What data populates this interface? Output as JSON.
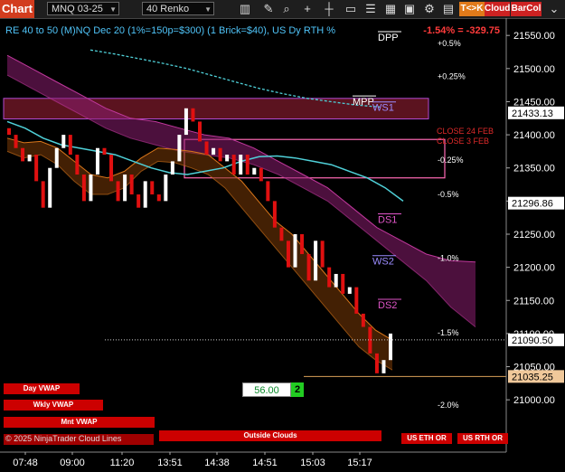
{
  "toolbar": {
    "chart_label": "Chart",
    "instrument": "MNQ 03-25",
    "period": "40 Renko",
    "buttons": [
      {
        "label": "T<>K",
        "color": "#e07a1a"
      },
      {
        "label": "Cloud",
        "color": "#cc2222"
      },
      {
        "label": "BarCol",
        "color": "#cc2222"
      }
    ],
    "icons": [
      "bars-icon",
      "pencil-icon",
      "zoom-icon",
      "plus-icon",
      "crosshair-icon",
      "data-box-icon",
      "list-icon",
      "grid-icon",
      "window-icon",
      "strategy-icon",
      "tile-icon"
    ]
  },
  "header": {
    "info": "RE 40 to 50 (M)NQ Dec 20 (1%=150p=$300) (1 Brick=$40), US Dy RTH %",
    "change": "-1.54% = -329.75"
  },
  "bottom_buttons": [
    {
      "label": "Day VWAP"
    },
    {
      "label": "Wkly VWAP"
    },
    {
      "label": "Mnt VWAP"
    },
    {
      "label": "Outside Clouds"
    },
    {
      "label": "US ETH OR"
    },
    {
      "label": "US RTH OR"
    }
  ],
  "copyright": "© 2025 NinjaTrader Cloud Lines",
  "signal": {
    "value": "56.00",
    "badge": "2"
  },
  "chart_data": {
    "type": "line",
    "title": "",
    "xlabel": "",
    "ylabel": "",
    "ylim": [
      20962,
      21568
    ],
    "x_ticks": [
      "07:48",
      "09:00",
      "11:20",
      "13:51",
      "14:38",
      "14:51",
      "15:03",
      "15:17"
    ],
    "y_ticks": [
      21000,
      21050,
      21100,
      21150,
      21200,
      21250,
      21300,
      21350,
      21400,
      21450,
      21500,
      21550
    ],
    "price_boxes": [
      {
        "label": "21433.13",
        "value": 21433.13,
        "bg": "#ffffff",
        "fg": "#000000"
      },
      {
        "label": "21296.86",
        "value": 21296.86,
        "bg": "#ffffff",
        "fg": "#000000"
      },
      {
        "label": "21090.50",
        "value": 21090.5,
        "bg": "#ffffff",
        "fg": "#000000"
      },
      {
        "label": "21035.25",
        "value": 21035.25,
        "bg": "#f0c89a",
        "fg": "#000000"
      }
    ],
    "levels": [
      {
        "label": "DPP",
        "value": 21542,
        "color": "#ffffff"
      },
      {
        "label": "MPP",
        "value": 21445,
        "color": "#ffffff"
      },
      {
        "label": "WS1",
        "value": 21436,
        "color": "#9b8cff"
      },
      {
        "label": "DS1",
        "value": 21267,
        "color": "#e055c8"
      },
      {
        "label": "WS2",
        "value": 21204,
        "color": "#9b8cff"
      },
      {
        "label": "DS2",
        "value": 21138,
        "color": "#e055c8"
      }
    ],
    "pct_labels": [
      {
        "label": "+0.5%",
        "value": 21534
      },
      {
        "label": "+0.25%",
        "value": 21484
      },
      {
        "label": "-0.25%",
        "value": 21358
      },
      {
        "label": "-0.5%",
        "value": 21306
      },
      {
        "label": "-1.0%",
        "value": 21210
      },
      {
        "label": "-1.5%",
        "value": 21097
      },
      {
        "label": "-2.0%",
        "value": 20988
      }
    ],
    "annotations": [
      {
        "label": "CLOSE 24 FEB",
        "value": 21415
      },
      {
        "label": "CLOSE 3 FEB",
        "value": 21400
      }
    ],
    "series": [
      {
        "name": "Renko",
        "values": [
          21400,
          21380,
          21360,
          21370,
          21330,
          21290,
          21350,
          21380,
          21400,
          21370,
          21340,
          21300,
          21340,
          21380,
          21370,
          21330,
          21300,
          21340,
          21310,
          21290,
          21330,
          21310,
          21300,
          21340,
          21360,
          21400,
          21440,
          21420,
          21390,
          21370,
          21380,
          21360,
          21370,
          21340,
          21370,
          21340,
          21350,
          21330,
          21300,
          21260,
          21240,
          21200,
          21250,
          21220,
          21180,
          21240,
          21200,
          21170,
          21190,
          21160,
          21170,
          21130,
          21110,
          21070,
          21040,
          21060,
          21100
        ]
      },
      {
        "name": "Cyan MA",
        "values": [
          21420,
          21410,
          21395,
          21385,
          21380,
          21375,
          21370,
          21360,
          21350,
          21343,
          21340,
          21345,
          21350,
          21360,
          21367,
          21368,
          21365,
          21360,
          21355,
          21345,
          21335,
          21320,
          21300
        ]
      },
      {
        "name": "Dashed MA",
        "values": [
          21528,
          21522,
          21515,
          21508,
          21500,
          21490,
          21480,
          21470,
          21462,
          21455,
          21450,
          21445,
          21442
        ]
      },
      {
        "name": "Orange Cloud Upper",
        "values": [
          21395,
          21388,
          21390,
          21380,
          21360,
          21340,
          21335,
          21345,
          21365,
          21380,
          21378,
          21375,
          21370,
          21350,
          21330,
          21300,
          21270,
          21250,
          21220,
          21190,
          21160,
          21130,
          21105,
          21090
        ]
      },
      {
        "name": "Orange Cloud Lower",
        "values": [
          21375,
          21365,
          21370,
          21355,
          21330,
          21310,
          21310,
          21320,
          21345,
          21360,
          21358,
          21350,
          21340,
          21320,
          21290,
          21260,
          21230,
          21200,
          21170,
          21140,
          21110,
          21080,
          21060,
          21045
        ]
      },
      {
        "name": "Magenta Cloud Upper",
        "values": [
          21520,
          21500,
          21480,
          21460,
          21440,
          21425,
          21420,
          21410,
          21400,
          21395,
          21380,
          21360,
          21340,
          21320,
          21290,
          21260,
          21240,
          21220,
          21210,
          21208
        ]
      },
      {
        "name": "Magenta Cloud Lower",
        "values": [
          21490,
          21470,
          21450,
          21430,
          21410,
          21395,
          21385,
          21375,
          21370,
          21365,
          21355,
          21340,
          21320,
          21300,
          21270,
          21240,
          21210,
          21180,
          21140,
          21110
        ]
      }
    ],
    "zones": [
      {
        "from": 21424,
        "to": 21455,
        "color": "#7a1a2a"
      },
      {
        "from": 21335,
        "to": 21393,
        "color": "#ff69b4"
      }
    ],
    "colors": {
      "up_brick": "#ffffff",
      "down_brick": "#e01010",
      "cyan_ma": "#4fd0d8",
      "orange_cloud": "#d9761a",
      "magenta_cloud": "#8b1e6f",
      "axis_text": "#ffffff"
    }
  }
}
